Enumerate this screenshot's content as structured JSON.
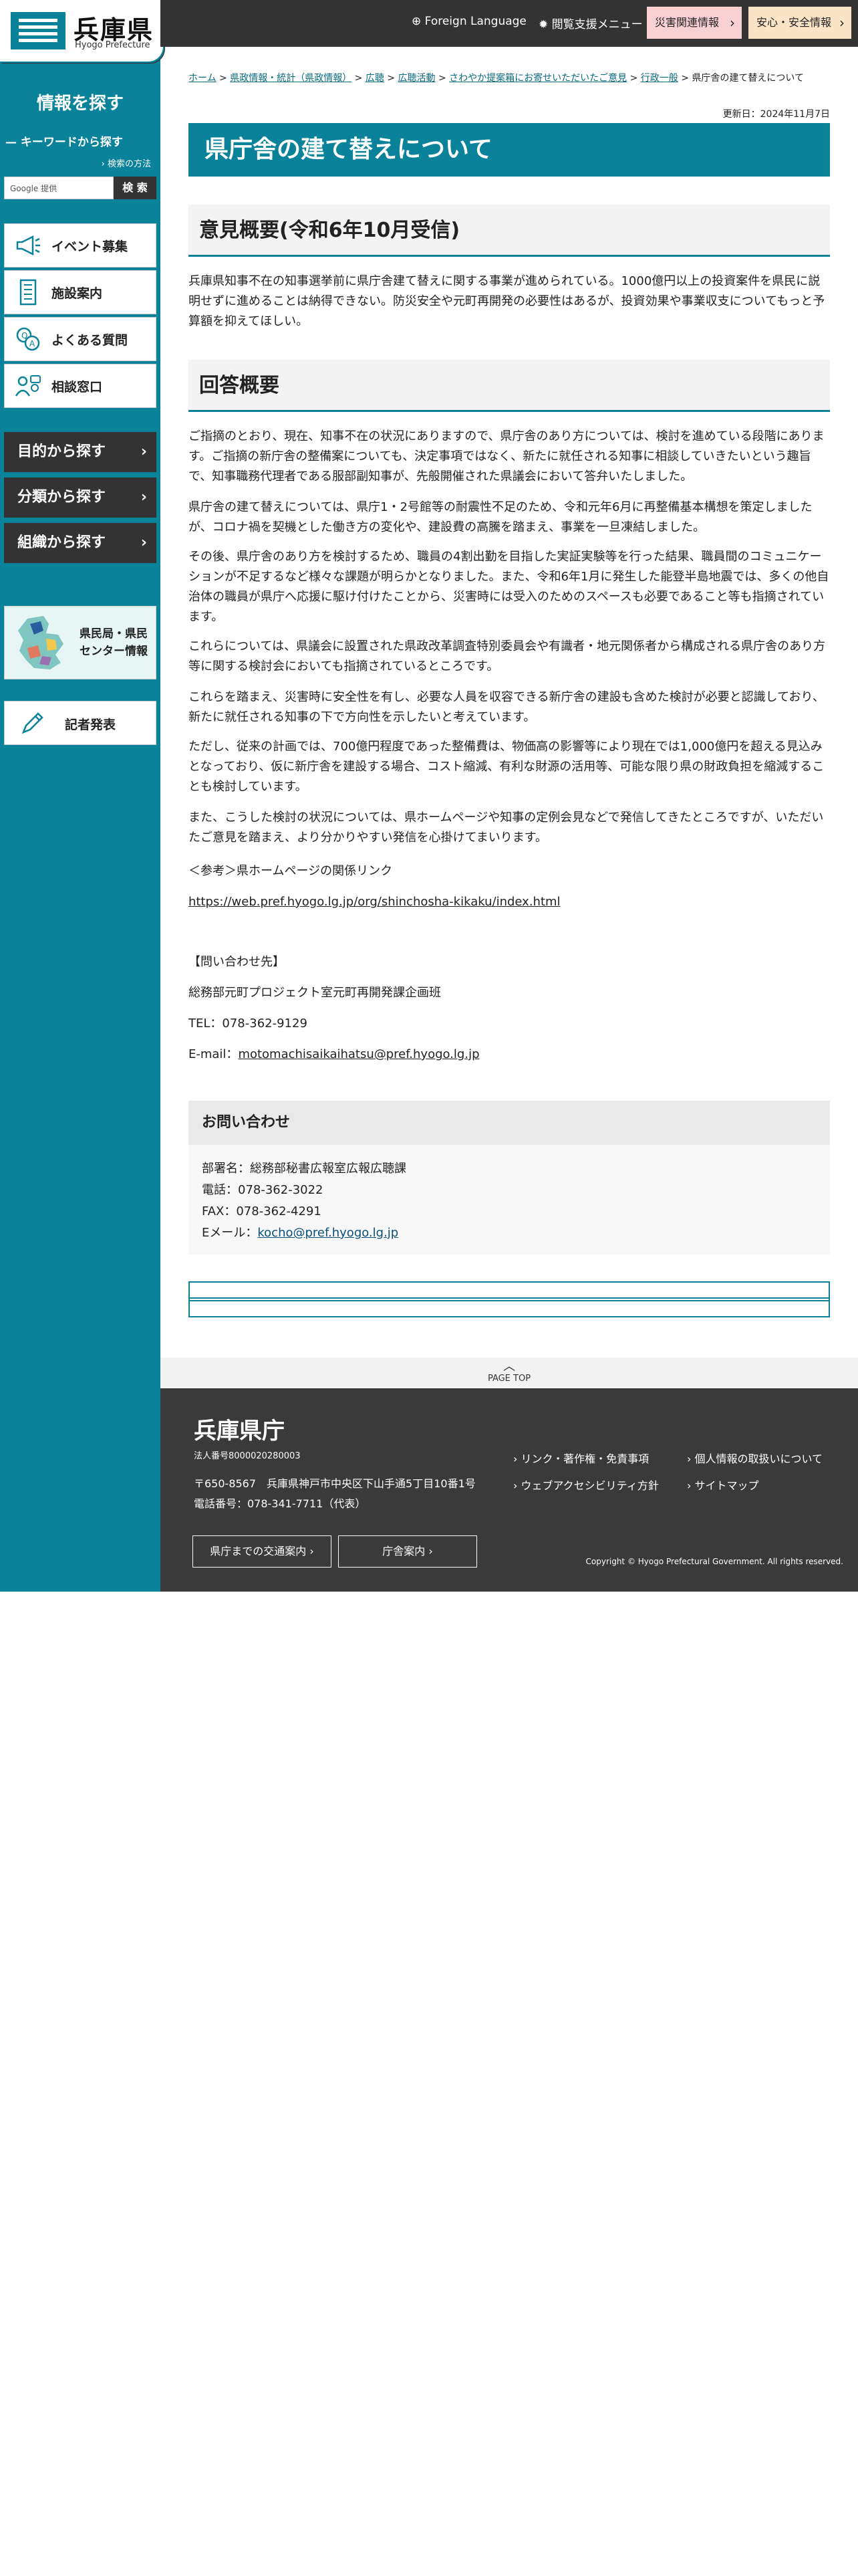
{
  "logo": {
    "name": "兵庫県",
    "sub": "Hyogo Prefecture"
  },
  "sidebar": {
    "title": "情報を探す",
    "keyword_label": "キーワードから探す",
    "search_howto": "検索の方法",
    "search_placeholder": "Google 提供",
    "search_button": "検 索",
    "menu_white": [
      "イベント募集",
      "施設案内",
      "よくある質問",
      "相談窓口"
    ],
    "menu_dark": [
      "目的から探す",
      "分類から探す",
      "組織から探す"
    ],
    "center_label_1": "県民局・県民",
    "center_label_2": "センター情報",
    "press_label": "記者発表"
  },
  "header": {
    "foreign_language": "Foreign Language",
    "browse_support": "閲覧支援メニュー",
    "disaster": "災害関連情報",
    "safety": "安心・安全情報"
  },
  "breadcrumb": {
    "items": [
      "ホーム",
      "県政情報・統計（県政情報）",
      "広聴",
      "広聴活動",
      "さわやか提案箱にお寄せいただいたご意見",
      "行政一般"
    ],
    "current": "県庁舎の建て替えについて"
  },
  "updated": "更新日：2024年11月7日",
  "page_title": "県庁舎の建て替えについて",
  "opinion": {
    "heading": "意見概要(令和6年10月受信)",
    "text": "兵庫県知事不在の知事選挙前に県庁舎建て替えに関する事業が進められている。1000億円以上の投資案件を県民に説明せずに進めることは納得できない。防災安全や元町再開発の必要性はあるが、投資効果や事業収支についてもっと予算額を抑えてほしい。"
  },
  "answer": {
    "heading": "回答概要",
    "paragraphs": [
      "ご指摘のとおり、現在、知事不在の状況にありますので、県庁舎のあり方については、検討を進めている段階にあります。ご指摘の新庁舎の整備案についても、決定事項ではなく、新たに就任される知事に相談していきたいという趣旨で、知事職務代理者である服部副知事が、先般開催された県議会において答弁いたしました。",
      "県庁舎の建て替えについては、県庁1・2号館等の耐震性不足のため、令和元年6月に再整備基本構想を策定しましたが、コロナ禍を契機とした働き方の変化や、建設費の高騰を踏まえ、事業を一旦凍結しました。",
      "その後、県庁舎のあり方を検討するため、職員の4割出勤を目指した実証実験等を行った結果、職員間のコミュニケーションが不足するなど様々な課題が明らかとなりました。また、令和6年1月に発生した能登半島地震では、多くの他自治体の職員が県庁へ応援に駆け付けたことから、災害時には受入のためのスペースも必要であること等も指摘されています。",
      "これらについては、県議会に設置された県政改革調査特別委員会や有識者・地元関係者から構成される県庁舎のあり方等に関する検討会においても指摘されているところです。",
      "これらを踏まえ、災害時に安全性を有し、必要な人員を収容できる新庁舎の建設も含めた検討が必要と認識しており、新たに就任される知事の下で方向性を示したいと考えています。",
      "ただし、従来の計画では、700億円程度であった整備費は、物価高の影響等により現在では1,000億円を超える見込みとなっており、仮に新庁舎を建設する場合、コスト縮減、有利な財源の活用等、可能な限り県の財政負担を縮減することも検討しています。",
      "また、こうした検討の状況については、県ホームページや知事の定例会見などで発信してきたところですが、いただいたご意見を踏まえ、より分かりやすい発信を心掛けてまいります。"
    ],
    "ref_label": "＜参考＞県ホームページの関係リンク",
    "ref_link": "https://web.pref.hyogo.lg.jp/org/shinchosha-kikaku/index.html",
    "inquiry_label": "【問い合わせ先】",
    "inquiry_dept": "総務部元町プロジェクト室元町再開発課企画班",
    "inquiry_tel": "TEL：078-362-9129",
    "inquiry_email_label": "E-mail：",
    "inquiry_email": "motomachisaikaihatsu@pref.hyogo.lg.jp"
  },
  "contact": {
    "heading": "お問い合わせ",
    "dept": "部署名：総務部秘書広報室広報広聴課",
    "tel": "電話：078-362-3022",
    "fax": "FAX：078-362-4291",
    "email_label": "Eメール：",
    "email": "kocho@pref.hyogo.lg.jp"
  },
  "pagetop": "PAGE TOP",
  "footer": {
    "title": "兵庫県庁",
    "corp_no": "法人番号8000020280003",
    "address": "〒650-8567　兵庫県神戸市中央区下山手通5丁目10番1号",
    "phone": "電話番号：078-341-7711（代表）",
    "btn_access": "県庁までの交通案内",
    "btn_building": "庁舎案内",
    "links": [
      "リンク・著作権・免責事項",
      "個人情報の取扱いについて",
      "ウェブアクセシビリティ方針",
      "サイトマップ"
    ],
    "copyright": "Copyright © Hyogo Prefectural Government. All rights reserved."
  },
  "colors": {
    "accent": "#0a8299",
    "dark": "#333333",
    "disaster": "#f9d0d2",
    "safety": "#fbe3c6"
  },
  "icons": [
    "megaphone-icon",
    "building-icon",
    "faq-icon",
    "consult-icon",
    "map-icon",
    "pen-icon",
    "globe-icon",
    "gear-icon",
    "chevron-right-icon",
    "arrow-up-icon"
  ]
}
